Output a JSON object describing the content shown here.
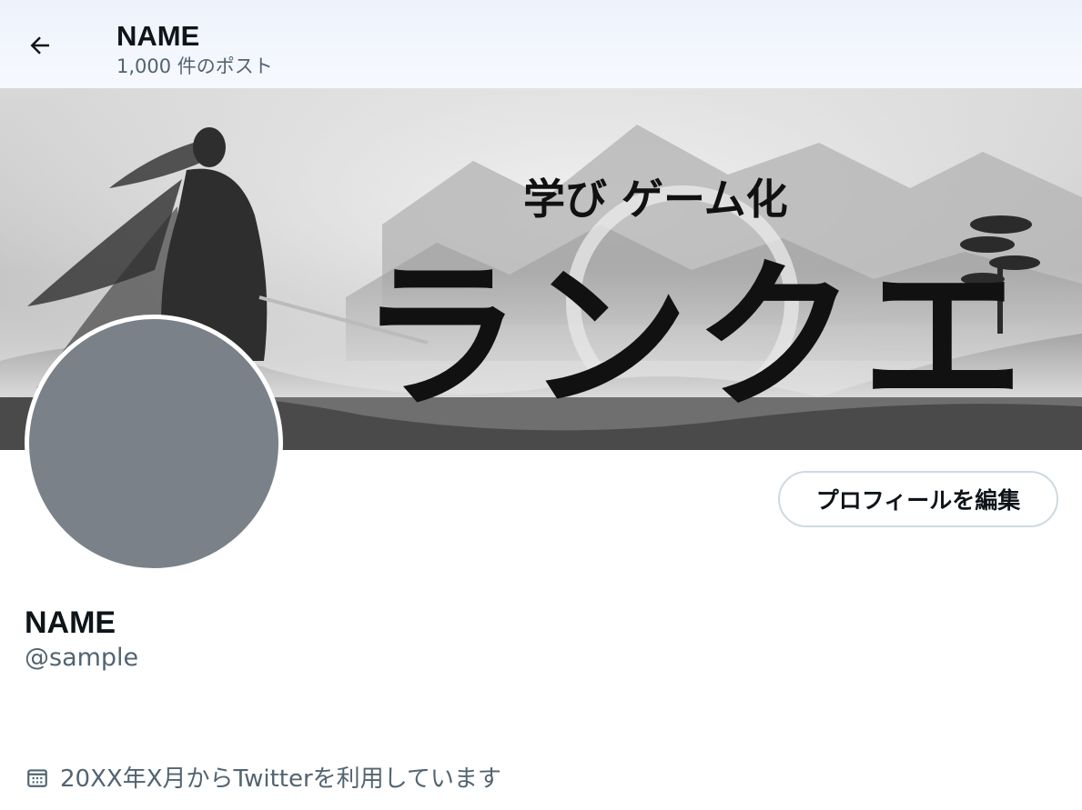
{
  "header": {
    "name": "NAME",
    "post_count": "1,000 件のポスト"
  },
  "banner": {
    "subtitle": "学び ゲーム化",
    "title": "ランクエ"
  },
  "profile": {
    "name": "NAME",
    "handle": "@sample",
    "edit_button_label": "プロフィールを編集",
    "joined_text": "20XX年X月からTwitterを利用しています"
  },
  "colors": {
    "text_primary": "#0f1419",
    "text_secondary": "#536471",
    "avatar_placeholder": "#7a8188",
    "button_border": "#cfd9de",
    "header_bg": "#eef2fb"
  },
  "icons": {
    "back": "arrow-left-icon",
    "joined": "calendar-icon"
  }
}
